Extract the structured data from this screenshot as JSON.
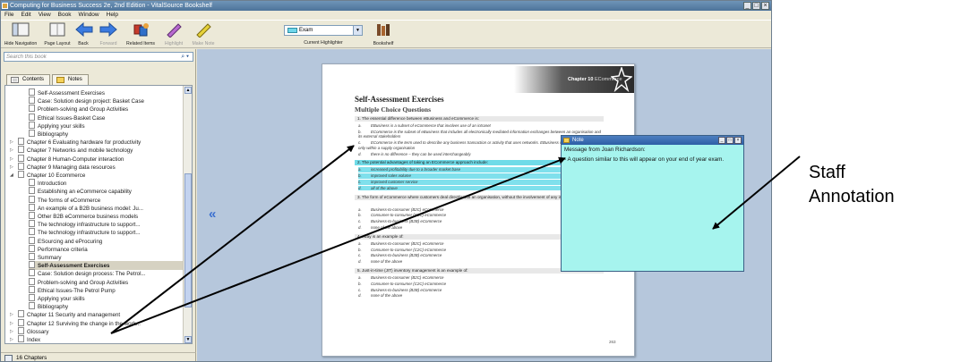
{
  "window": {
    "title": "Computing for Business Success 2e, 2nd Edition - VitalSource Bookshelf",
    "controls": [
      "_",
      "□",
      "×"
    ]
  },
  "menu": [
    "File",
    "Edit",
    "View",
    "Book",
    "Window",
    "Help"
  ],
  "toolbar": {
    "hide_navigation": "Hide Navigation",
    "page_layout": "Page Layout",
    "back": "Back",
    "forward": "Forward",
    "related_items": "Related Items",
    "highlight": "Highlight",
    "make_note": "Make Note",
    "current_highlighter_label": "Current Highlighter",
    "current_highlighter_value": "Exam",
    "bookshelf": "Bookshelf"
  },
  "sidebar": {
    "search_placeholder": "Search this book",
    "tabs": [
      "Contents",
      "Notes"
    ],
    "tree": [
      {
        "label": "Self-Assessment Exercises",
        "level": 2
      },
      {
        "label": "Case: Solution design project: Basket Case",
        "level": 2
      },
      {
        "label": "Problem-solving and Group Activities",
        "level": 2
      },
      {
        "label": "Ethical Issues-Basket Case",
        "level": 2
      },
      {
        "label": "Applying your skills",
        "level": 2
      },
      {
        "label": "Bibliography",
        "level": 2
      },
      {
        "label": "Chapter 6 Evaluating hardware for productivity",
        "level": 1
      },
      {
        "label": "Chapter 7 Networks and mobile technology",
        "level": 1
      },
      {
        "label": "Chapter 8 Human-Computer interaction",
        "level": 1
      },
      {
        "label": "Chapter 9 Managing data resources",
        "level": 1
      },
      {
        "label": "Chapter 10 Ecommerce",
        "level": 1
      },
      {
        "label": "Introduction",
        "level": 2
      },
      {
        "label": "Establishing an eCommerce capability",
        "level": 2
      },
      {
        "label": "The forms of eCommerce",
        "level": 2
      },
      {
        "label": "An example of a B2B business model: Ju...",
        "level": 2
      },
      {
        "label": "Other B2B eCommerce business models",
        "level": 2
      },
      {
        "label": "The technology infrastructure to support...",
        "level": 2
      },
      {
        "label": "The technology infrastructure to support...",
        "level": 2
      },
      {
        "label": "ESourcing and eProcuring",
        "level": 2
      },
      {
        "label": "Performance criteria",
        "level": 2
      },
      {
        "label": "Summary",
        "level": 2
      },
      {
        "label": "Self-Assessment Exercises",
        "level": 2,
        "selected": true
      },
      {
        "label": "Case: Solution design process: The Petrol...",
        "level": 2
      },
      {
        "label": "Problem-solving and Group Activities",
        "level": 2
      },
      {
        "label": "Ethical Issues-The Petrol Pump",
        "level": 2
      },
      {
        "label": "Applying your skills",
        "level": 2
      },
      {
        "label": "Bibliography",
        "level": 2
      },
      {
        "label": "Chapter 11 Security and management",
        "level": 1
      },
      {
        "label": "Chapter 12 Surviving the change in the work...",
        "level": 1
      },
      {
        "label": "Glossary",
        "level": 1
      },
      {
        "label": "Index",
        "level": 1
      }
    ],
    "status": "16 Chapters"
  },
  "page": {
    "chapter_label": "Chapter 10",
    "chapter_name": "ECommerce",
    "heading": "Self-Assessment Exercises",
    "subheading": "Multiple Choice Questions",
    "questions": [
      {
        "q": "1. The essential difference between eBusiness and eCommerce is:",
        "opts": [
          {
            "l": "a.",
            "t": "EBusiness is a subset of eCommerce that involves use of an intranet"
          },
          {
            "l": "b.",
            "t": "ECommerce is the subset of eBusiness that includes all electronically mediated information exchanges between an organisation and its external stakeholders"
          },
          {
            "l": "c.",
            "t": "ECommerce is the term used to describe any business transaction or activity that uses networks. EBusiness includes communication only within a supply organisation"
          },
          {
            "l": "d.",
            "t": "there is no difference – they can be used interchangeably"
          }
        ]
      },
      {
        "q": "2. The potential advantages of taking an ECommerce approach include:",
        "highlight": true,
        "opts": [
          {
            "l": "a.",
            "t": "increased profitability due to a broader market base"
          },
          {
            "l": "b.",
            "t": "improved sales volume"
          },
          {
            "l": "c.",
            "t": "improved customer service"
          },
          {
            "l": "d.",
            "t": "all of the above"
          }
        ]
      },
      {
        "q": "3. The form of eCommerce where customers deal directly with an organisation, without the involvement of any intermediaries is termed:",
        "opts": [
          {
            "l": "a.",
            "t": "Business-to-consumer (B2C) eCommerce"
          },
          {
            "l": "b.",
            "t": "Consumer-to-consumer (C2C) eCommerce"
          },
          {
            "l": "c.",
            "t": "Business-to-business (B2B) eCommerce"
          },
          {
            "l": "d.",
            "t": "none of the above"
          }
        ]
      },
      {
        "q": "4. eBay is an example of:",
        "opts": [
          {
            "l": "a.",
            "t": "Business-to-consumer (B2C) eCommerce"
          },
          {
            "l": "b.",
            "t": "Consumer-to-consumer (C2C) eCommerce"
          },
          {
            "l": "c.",
            "t": "Business-to-business (B2B) eCommerce"
          },
          {
            "l": "d.",
            "t": "none of the above"
          }
        ]
      },
      {
        "q": "5. Just-in-time (JIT) inventory management is an example of:",
        "opts": [
          {
            "l": "a.",
            "t": "Business-to-consumer (B2C) eCommerce"
          },
          {
            "l": "b.",
            "t": "Consumer-to-consumer (C2C) eCommerce"
          },
          {
            "l": "c.",
            "t": "Business-to-business (B2B) eCommerce"
          },
          {
            "l": "d.",
            "t": "none of the above"
          }
        ]
      }
    ],
    "page_number": "263"
  },
  "note": {
    "title": "Note",
    "from": "Message from Joan Richardson:",
    "body": "- A question similar to this will appear on your end of year exam."
  },
  "annotation": {
    "line1": "Staff",
    "line2": "Annotation"
  },
  "colors": {
    "highlighter": "#6fdbe8",
    "note_background": "#a6f4ee",
    "reader_background": "#b6c7dc"
  }
}
